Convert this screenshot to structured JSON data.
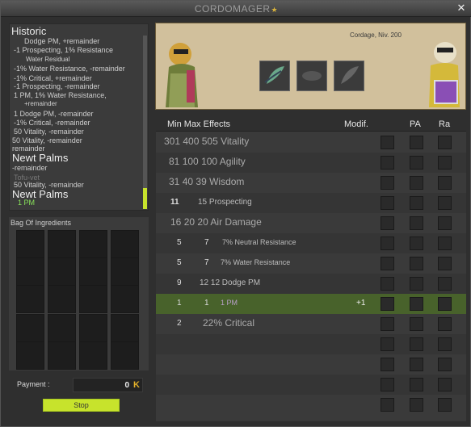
{
  "window": {
    "title": "CORDOMAGER",
    "close_label": "✕"
  },
  "historic": {
    "title": "Historic",
    "lines": [
      "Dodge PM, +remainder",
      "-1 Prospecting, 1% Resistance",
      "Water Residual",
      "-1% Water Resistance, -remainder",
      "-1% Critical, +remainder",
      "-1 Prospecting, -remainder",
      "1 PM, 1% Water Resistance,",
      "+remainder",
      "1 Dodge PM, -remainder",
      "-1% Critical, -remainder",
      "50 Vitality, -remainder",
      "50 Vitality, -remainder",
      "remainder",
      "Newt Palms",
      "-remainder",
      "Tofu-vet",
      "50 Vitality, -remainder",
      "Newt Palms",
      "1 PM"
    ]
  },
  "bag": {
    "title": "Bag Of Ingredients"
  },
  "payment": {
    "label": "Payment :",
    "value": "0",
    "currency": "K"
  },
  "stop_button": {
    "label": "Stop"
  },
  "banner": {
    "nickname": "Cordage, Niv. 200"
  },
  "effects": {
    "headers": {
      "minmax": "Min Max Effects",
      "modif": "Modif.",
      "pa": "PA",
      "ra": "Ra"
    },
    "rows": [
      {
        "min": "301",
        "max": "400",
        "eff": "505 Vitality",
        "modif": ""
      },
      {
        "min": "81",
        "max": "100",
        "eff": "100 Agility",
        "modif": ""
      },
      {
        "min": "31",
        "max": "40",
        "eff": "39 Wisdom",
        "modif": ""
      },
      {
        "min": "11",
        "max": "",
        "eff": "15 Prospecting",
        "modif": ""
      },
      {
        "min": "16",
        "max": "20",
        "eff": "20 Air Damage",
        "modif": ""
      },
      {
        "min": "5",
        "max": "7",
        "eff": "7% Neutral Resistance",
        "modif": ""
      },
      {
        "min": "5",
        "max": "7",
        "eff": "7% Water Resistance",
        "modif": ""
      },
      {
        "min": "9",
        "max": "12",
        "eff": "12 Dodge PM",
        "modif": ""
      },
      {
        "min": "1",
        "max": "1",
        "eff": "1 PM",
        "modif": "+1"
      },
      {
        "min": "2",
        "max": "",
        "eff": "22% Critical",
        "modif": ""
      }
    ]
  }
}
